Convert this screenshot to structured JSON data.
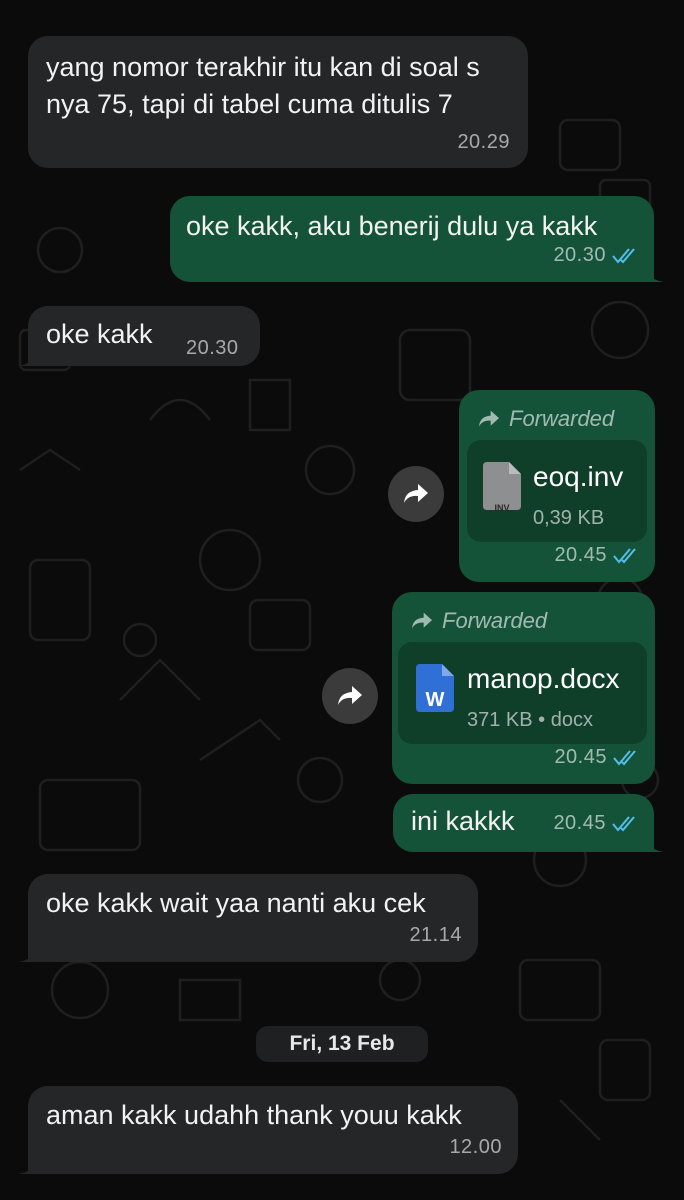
{
  "messages": [
    {
      "text": "yang nomor terakhir itu kan di soal s nya 75, tapi di tabel cuma ditulis 7",
      "time": "20.29"
    },
    {
      "text": "oke kakk, aku benerij dulu ya kakk",
      "time": "20.30"
    },
    {
      "text": "oke kakk",
      "time": "20.30"
    },
    {
      "forwarded": "Forwarded",
      "file_name": "eoq.inv",
      "file_meta": "0,39 KB",
      "file_icon_label": "INV",
      "time": "20.45"
    },
    {
      "forwarded": "Forwarded",
      "file_name": "manop.docx",
      "file_meta": "371 KB • docx",
      "file_icon_label": "W",
      "time": "20.45"
    },
    {
      "text": "ini kakkk",
      "time": "20.45"
    },
    {
      "text": "oke kakk wait yaa nanti aku cek",
      "time": "21.14"
    },
    {
      "text": "aman kakk udahh thank youu kakk",
      "time": "12.00"
    }
  ],
  "date_separator": "Fri, 13 Feb",
  "icons": {
    "read_receipt": "double-check-icon",
    "forward": "forward-arrow-icon",
    "doc_word": "word-doc-icon",
    "doc_generic": "generic-file-icon"
  },
  "colors": {
    "incoming": "#252627",
    "outgoing": "#155338",
    "read_check": "#53bdeb"
  }
}
